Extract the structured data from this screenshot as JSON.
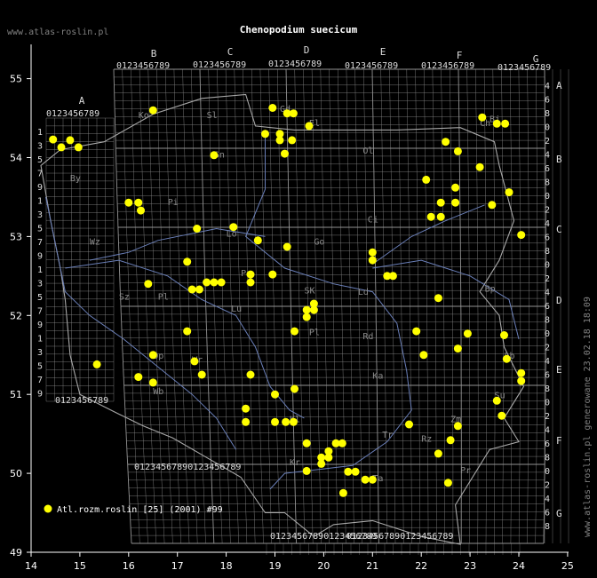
{
  "header": {
    "site": "www.atlas-roslin.pl",
    "title": "Chenopodium suecicum"
  },
  "footer_vertical": "www.atlas-roslin.pl generowane 23.02.18 18:09",
  "legend": {
    "label": "Atl.rozm.roslin [25] (2001) #99",
    "color": "#ffff00"
  },
  "colors": {
    "background": "#000000",
    "grid": "#9a9a9a",
    "river": "#6a7fb8",
    "border": "#a8a8a8",
    "point": "#ffff00",
    "text": "#ffffff"
  },
  "axes": {
    "x_ticks": [
      "14",
      "15",
      "16",
      "17",
      "18",
      "19",
      "20",
      "21",
      "22",
      "23",
      "24",
      "25"
    ],
    "y_ticks": [
      "49",
      "50",
      "51",
      "52",
      "53",
      "54",
      "55"
    ]
  },
  "grid_columns": [
    "A",
    "B",
    "C",
    "D",
    "E",
    "F",
    "G"
  ],
  "grid_rows_right": [
    "A",
    "B",
    "C",
    "D",
    "E",
    "F",
    "G"
  ],
  "top_digits": "0123456789",
  "bottom_digits": "0123456789",
  "region_labels": [
    "Ko",
    "Sl",
    "Gd",
    "El",
    "Ol",
    "Sn",
    "Bi",
    "Pi",
    "By",
    "Wz",
    "Ci",
    "Go",
    "Lo",
    "Po",
    "SK",
    "Ld",
    "Lu",
    "Sz",
    "Pl",
    "Rd",
    "Pl",
    "Wr",
    "Op",
    "Lb",
    "Ka",
    "Wb",
    "Kl",
    "Tr",
    "Kr",
    "Ta",
    "Rz",
    "Pr",
    "Zm",
    "Su",
    "Ch",
    "Bp"
  ],
  "left_row_digits": [
    "1",
    "3",
    "5",
    "7",
    "9",
    "1",
    "3",
    "5",
    "7",
    "9",
    "1",
    "3",
    "5",
    "7",
    "9",
    "1",
    "3",
    "5",
    "7",
    "9"
  ],
  "right_row_digits": [
    "4",
    "6",
    "8",
    "0",
    "2",
    "4",
    "6",
    "8",
    "0",
    "2",
    "4",
    "6",
    "8",
    "0",
    "2",
    "4",
    "6",
    "8",
    "0",
    "2",
    "4",
    "6",
    "8",
    "0",
    "2",
    "4",
    "6",
    "8",
    "0",
    "2",
    "4",
    "6",
    "8"
  ],
  "points": [
    {
      "lon": 14.45,
      "lat": 54.23
    },
    {
      "lon": 14.62,
      "lat": 54.13
    },
    {
      "lon": 14.8,
      "lat": 54.22
    },
    {
      "lon": 14.97,
      "lat": 54.13
    },
    {
      "lon": 16.5,
      "lat": 54.6
    },
    {
      "lon": 18.95,
      "lat": 54.63
    },
    {
      "lon": 19.25,
      "lat": 54.56
    },
    {
      "lon": 19.38,
      "lat": 54.56
    },
    {
      "lon": 19.7,
      "lat": 54.4
    },
    {
      "lon": 18.8,
      "lat": 54.3
    },
    {
      "lon": 19.1,
      "lat": 54.3
    },
    {
      "lon": 19.1,
      "lat": 54.22
    },
    {
      "lon": 19.35,
      "lat": 54.22
    },
    {
      "lon": 19.2,
      "lat": 54.05
    },
    {
      "lon": 17.75,
      "lat": 54.03
    },
    {
      "lon": 23.25,
      "lat": 54.51
    },
    {
      "lon": 23.55,
      "lat": 54.43
    },
    {
      "lon": 23.72,
      "lat": 54.43
    },
    {
      "lon": 22.5,
      "lat": 54.2
    },
    {
      "lon": 22.75,
      "lat": 54.08
    },
    {
      "lon": 23.2,
      "lat": 53.88
    },
    {
      "lon": 22.1,
      "lat": 53.72
    },
    {
      "lon": 22.7,
      "lat": 53.62
    },
    {
      "lon": 23.8,
      "lat": 53.56
    },
    {
      "lon": 22.4,
      "lat": 53.43
    },
    {
      "lon": 22.7,
      "lat": 53.43
    },
    {
      "lon": 23.45,
      "lat": 53.4
    },
    {
      "lon": 22.2,
      "lat": 53.25
    },
    {
      "lon": 22.4,
      "lat": 53.25
    },
    {
      "lon": 24.05,
      "lat": 53.02
    },
    {
      "lon": 16.0,
      "lat": 53.43
    },
    {
      "lon": 16.2,
      "lat": 53.43
    },
    {
      "lon": 16.25,
      "lat": 53.33
    },
    {
      "lon": 17.4,
      "lat": 53.1
    },
    {
      "lon": 18.15,
      "lat": 53.12
    },
    {
      "lon": 18.65,
      "lat": 52.95
    },
    {
      "lon": 19.25,
      "lat": 52.87
    },
    {
      "lon": 21.0,
      "lat": 52.8
    },
    {
      "lon": 21.0,
      "lat": 52.7
    },
    {
      "lon": 17.2,
      "lat": 52.68
    },
    {
      "lon": 18.5,
      "lat": 52.52
    },
    {
      "lon": 18.95,
      "lat": 52.52
    },
    {
      "lon": 21.3,
      "lat": 52.5
    },
    {
      "lon": 21.42,
      "lat": 52.5
    },
    {
      "lon": 16.4,
      "lat": 52.4
    },
    {
      "lon": 17.6,
      "lat": 52.42
    },
    {
      "lon": 17.75,
      "lat": 52.42
    },
    {
      "lon": 17.9,
      "lat": 52.42
    },
    {
      "lon": 18.5,
      "lat": 52.42
    },
    {
      "lon": 17.3,
      "lat": 52.33
    },
    {
      "lon": 17.45,
      "lat": 52.33
    },
    {
      "lon": 19.8,
      "lat": 52.15
    },
    {
      "lon": 19.65,
      "lat": 52.07
    },
    {
      "lon": 19.8,
      "lat": 52.07
    },
    {
      "lon": 19.65,
      "lat": 51.98
    },
    {
      "lon": 22.35,
      "lat": 52.22
    },
    {
      "lon": 17.2,
      "lat": 51.8
    },
    {
      "lon": 19.4,
      "lat": 51.8
    },
    {
      "lon": 21.9,
      "lat": 51.8
    },
    {
      "lon": 22.95,
      "lat": 51.77
    },
    {
      "lon": 23.7,
      "lat": 51.75
    },
    {
      "lon": 22.75,
      "lat": 51.58
    },
    {
      "lon": 22.05,
      "lat": 51.5
    },
    {
      "lon": 16.5,
      "lat": 51.5
    },
    {
      "lon": 17.35,
      "lat": 51.42
    },
    {
      "lon": 23.75,
      "lat": 51.45
    },
    {
      "lon": 15.35,
      "lat": 51.38
    },
    {
      "lon": 16.2,
      "lat": 51.22
    },
    {
      "lon": 16.5,
      "lat": 51.15
    },
    {
      "lon": 17.5,
      "lat": 51.25
    },
    {
      "lon": 18.5,
      "lat": 51.25
    },
    {
      "lon": 24.05,
      "lat": 51.27
    },
    {
      "lon": 24.05,
      "lat": 51.17
    },
    {
      "lon": 19.0,
      "lat": 51.0
    },
    {
      "lon": 19.4,
      "lat": 51.07
    },
    {
      "lon": 23.55,
      "lat": 50.92
    },
    {
      "lon": 23.65,
      "lat": 50.73
    },
    {
      "lon": 18.4,
      "lat": 50.82
    },
    {
      "lon": 18.4,
      "lat": 50.65
    },
    {
      "lon": 19.0,
      "lat": 50.65
    },
    {
      "lon": 19.22,
      "lat": 50.65
    },
    {
      "lon": 19.38,
      "lat": 50.65
    },
    {
      "lon": 21.75,
      "lat": 50.62
    },
    {
      "lon": 22.75,
      "lat": 50.6
    },
    {
      "lon": 22.6,
      "lat": 50.42
    },
    {
      "lon": 19.65,
      "lat": 50.38
    },
    {
      "lon": 20.25,
      "lat": 50.38
    },
    {
      "lon": 20.38,
      "lat": 50.38
    },
    {
      "lon": 20.1,
      "lat": 50.28
    },
    {
      "lon": 19.95,
      "lat": 50.2
    },
    {
      "lon": 20.1,
      "lat": 50.2
    },
    {
      "lon": 19.95,
      "lat": 50.12
    },
    {
      "lon": 19.65,
      "lat": 50.03
    },
    {
      "lon": 20.5,
      "lat": 50.02
    },
    {
      "lon": 20.65,
      "lat": 50.02
    },
    {
      "lon": 22.35,
      "lat": 50.25
    },
    {
      "lon": 20.85,
      "lat": 49.92
    },
    {
      "lon": 21.0,
      "lat": 49.92
    },
    {
      "lon": 20.4,
      "lat": 49.75
    },
    {
      "lon": 22.55,
      "lat": 49.88
    }
  ]
}
